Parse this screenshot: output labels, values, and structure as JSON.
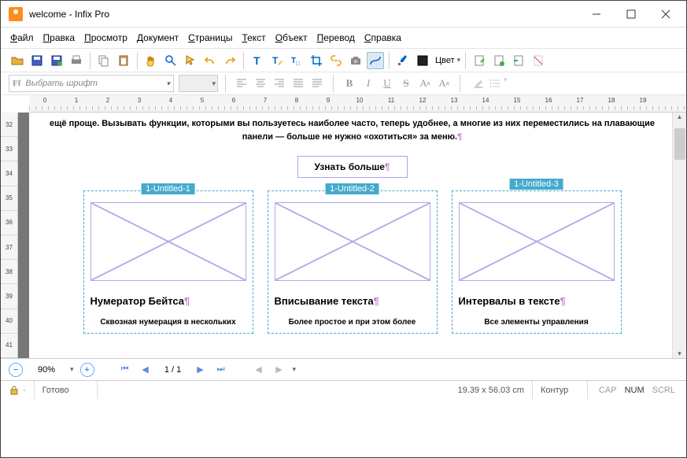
{
  "window": {
    "title": "welcome - Infix Pro"
  },
  "menu": [
    "Файл",
    "Правка",
    "Просмотр",
    "Документ",
    "Страницы",
    "Текст",
    "Объект",
    "Перевод",
    "Справка"
  ],
  "font": {
    "placeholder": "Выбрать шрифт"
  },
  "color_label": "Цвет",
  "ruler_h": [
    0,
    1,
    2,
    3,
    4,
    5,
    6,
    7,
    8,
    9,
    10,
    11,
    12,
    13,
    14,
    15,
    16,
    17,
    18,
    19
  ],
  "ruler_v": [
    32,
    33,
    34,
    35,
    36,
    37,
    38,
    39,
    40,
    41
  ],
  "document": {
    "intro": "ещё проще. Вызывать функции, которыми вы пользуетесь наиболее часто, теперь удобнее, а многие из них переместились на плавающие панели — больше не нужно «охотиться» за меню.",
    "learn_more": "Узнать больше",
    "cards": [
      {
        "label": "1-Untitled-1",
        "title": "Нумератор Бейтса",
        "desc": "Сквозная нумерация в нескольких"
      },
      {
        "label": "1-Untitled-2",
        "title": "Вписывание текста",
        "desc": "Более простое и при этом более"
      },
      {
        "label": "1-Untitled-3",
        "title": "Интервалы в тексте",
        "desc": "Все элементы управления"
      }
    ]
  },
  "nav": {
    "zoom": "90%",
    "page": "1 / 1"
  },
  "status": {
    "ready": "Готово",
    "coords": "19.39 x 56.03 cm",
    "mode": "Контур",
    "caps": [
      "CAP",
      "NUM",
      "SCRL"
    ]
  }
}
